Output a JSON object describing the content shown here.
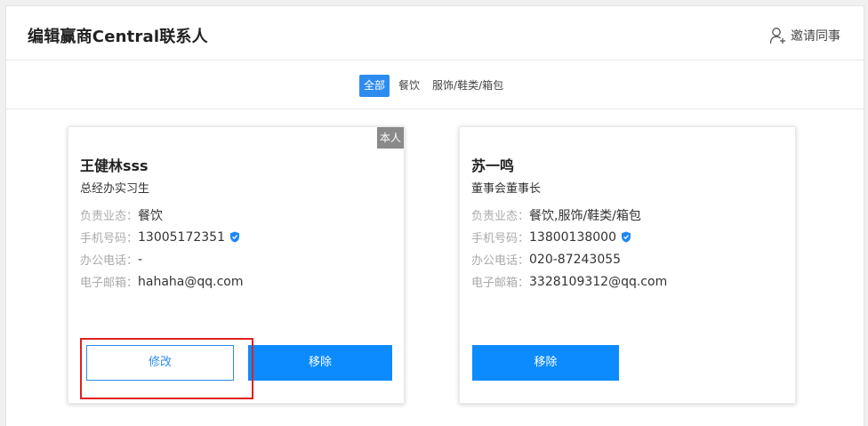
{
  "header": {
    "title": "编辑赢商Central联系人",
    "invite_label": "邀请同事"
  },
  "filters": [
    {
      "label": "全部",
      "active": true
    },
    {
      "label": "餐饮",
      "active": false
    },
    {
      "label": "服饰/鞋类/箱包",
      "active": false
    }
  ],
  "contacts": [
    {
      "badge": "本人",
      "name": "王健林sss",
      "title": "总经办实习生",
      "rows": [
        {
          "label": "负责业态：",
          "value": "餐饮"
        },
        {
          "label": "手机号码：",
          "value": "13005172351",
          "verified": true
        },
        {
          "label": "办公电话：",
          "value": "-"
        },
        {
          "label": "电子邮箱：",
          "value": "hahaha@qq.com"
        }
      ],
      "edit_label": "修改",
      "remove_label": "移除"
    },
    {
      "name": "苏一鸣",
      "title": "董事会董事长",
      "rows": [
        {
          "label": "负责业态：",
          "value": "餐饮,服饰/鞋类/箱包"
        },
        {
          "label": "手机号码：",
          "value": "13800138000",
          "verified": true
        },
        {
          "label": "办公电话：",
          "value": "020-87243055"
        },
        {
          "label": "电子邮箱：",
          "value": "3328109312@qq.com"
        }
      ],
      "remove_label": "移除"
    }
  ],
  "icons": {
    "invite": "add-user-icon",
    "verified": "verified-shield-icon"
  },
  "colors": {
    "primary": "#2d8cf0",
    "remove_button": "#0c8bff",
    "highlight": "#e02020"
  }
}
